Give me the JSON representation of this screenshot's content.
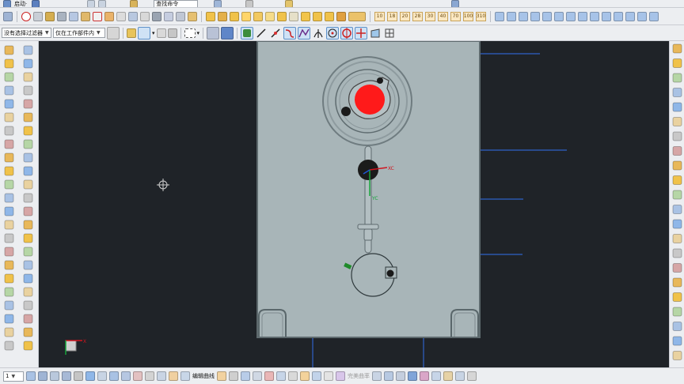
{
  "toolbar_top": {
    "start_menu_label": "启动·",
    "command_finder_label": "查找命令"
  },
  "toolbar_row2": {
    "number_buttons": [
      "10",
      "18",
      "20",
      "28",
      "30",
      "40",
      "70",
      "100",
      "310"
    ]
  },
  "selection_bar": {
    "filter_value": "没有选择过滤器",
    "scope_value": "仅在工作部件内"
  },
  "bottom_bar": {
    "layer_value": "1",
    "edit_curve_label": "编辑曲线",
    "perfect_label": "完美曲率"
  },
  "viewport": {
    "colors": {
      "background": "#1f2328",
      "part_face": "#a8b5b8",
      "part_edge": "#5e6a6e",
      "red_core": "#ff1a1a",
      "datum_line": "#2f62c8"
    },
    "csys": {
      "x_label": "XC",
      "y_label": "YC"
    },
    "triad": {
      "x_label": "X"
    }
  }
}
